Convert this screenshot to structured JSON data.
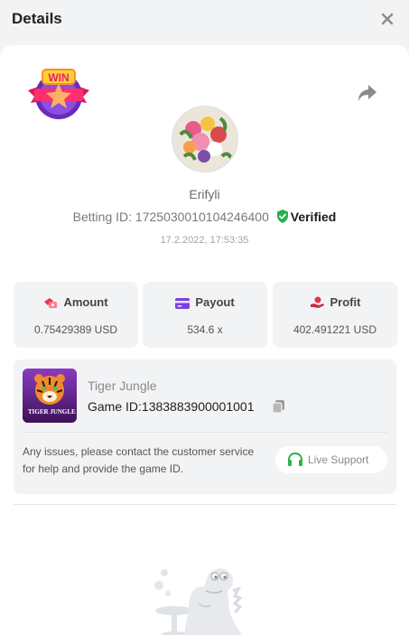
{
  "header": {
    "title": "Details",
    "close_icon": "close-icon"
  },
  "user": {
    "name": "Erifyli",
    "betting_id_label": "Betting ID:",
    "betting_id": "1725030010104246400",
    "verified_label": "Verified",
    "datetime": "17.2.2022, 17:53:35"
  },
  "badge": {
    "text": "WIN"
  },
  "stats": {
    "amount": {
      "label": "Amount",
      "value": "0.75429389 USD",
      "icon": "amount-icon"
    },
    "payout": {
      "label": "Payout",
      "value": "534.6 x",
      "icon": "card-icon"
    },
    "profit": {
      "label": "Profit",
      "value": "402.491221 USD",
      "icon": "profit-icon"
    }
  },
  "game": {
    "name": "Tiger Jungle",
    "id_label": "Game ID:",
    "id": "1383883900001001",
    "thumb_text": "TIGER JUNGLE"
  },
  "support": {
    "message": "Any issues, please contact the customer service for help and provide the game ID.",
    "button_label": "Live Support"
  },
  "colors": {
    "accent_red": "#e8334a",
    "accent_purple": "#7b3fe4",
    "verified_green": "#22b14c",
    "support_green": "#2bb24c"
  }
}
